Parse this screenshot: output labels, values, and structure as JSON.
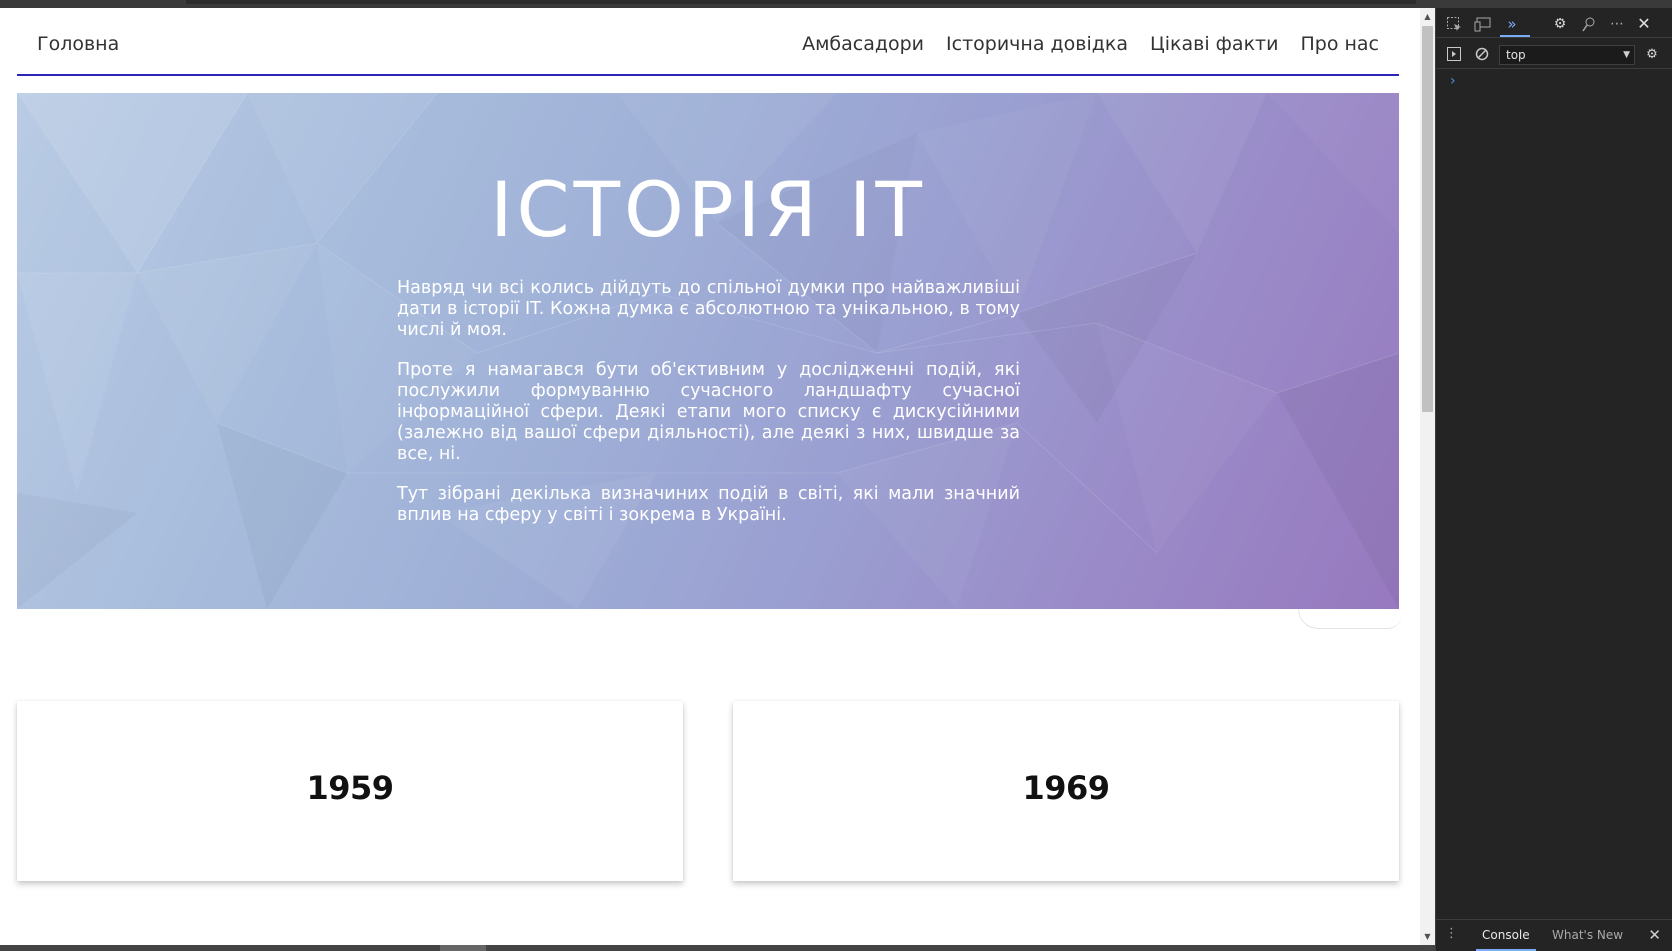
{
  "nav": {
    "home": "Головна",
    "links": [
      "Амбасадори",
      "Історична довідка",
      "Цікаві факти",
      "Про нас"
    ]
  },
  "hero": {
    "title": "ІСТОРІЯ IT",
    "paragraphs": [
      "Навряд чи всі колись дійдуть до спільної думки про найважливіші дати в історії IT. Кожна думка є абсолютною та унікальною, в тому числі й моя.",
      "Проте я намагався бути об'єктивним у дослідженні подій, які послужили формуванню сучасного ландшафту сучасної інформаційної сфери. Деякі етапи мого списку є дискусійними (залежно від вашої сфери діяльності), але деякі з них, швидше за все, ні.",
      "Тут зібрані декілька визначиних подій в світі, які мали значний вплив на сферу у світі і зокрема в Україні."
    ]
  },
  "cards": [
    {
      "year": "1959"
    },
    {
      "year": "1969"
    }
  ],
  "devtools": {
    "context": "top",
    "drawer_tabs": [
      "Console",
      "What's New"
    ]
  },
  "colors": {
    "nav_underline": "#2a25b8",
    "hero_start": "#b9cbe4",
    "hero_end": "#9779bf",
    "devtools_bg": "#242424"
  }
}
